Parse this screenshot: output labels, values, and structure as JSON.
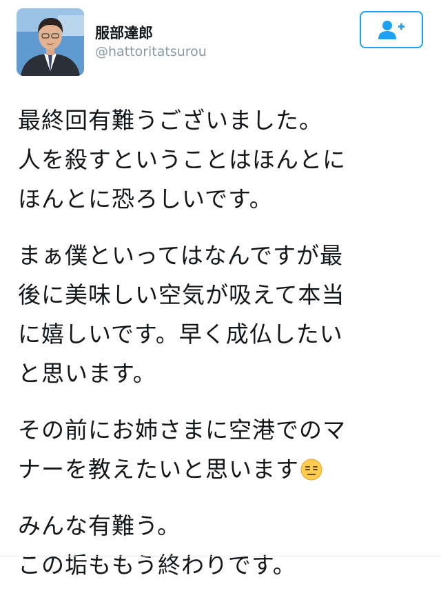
{
  "user": {
    "display_name": "服部達郎",
    "handle": "@hattoritatsurou"
  },
  "tweet": {
    "paragraphs": [
      {
        "lines": [
          "最終回有難うございました。",
          "人を殺すということはほんとに",
          "ほんとに恐ろしいです。"
        ]
      },
      {
        "lines": [
          "まぁ僕といってはなんですが最",
          "後に美味しい空気が吸えて本当",
          "に嬉しいです。早く成仏したい",
          "と思います。"
        ]
      },
      {
        "lines": [
          "その前にお姉さまに空港でのマ",
          "ナーを教えたいと思います"
        ]
      },
      {
        "lines": [
          "みんな有難う。",
          "この垢ももう終わりです。"
        ]
      }
    ]
  },
  "icons": {
    "follow": "add-user-icon",
    "emoji": "expressionless-face-emoji"
  },
  "colors": {
    "accent": "#1da1f2",
    "text": "#14171a",
    "muted": "#8899a6",
    "divider": "#e1e8ed"
  }
}
